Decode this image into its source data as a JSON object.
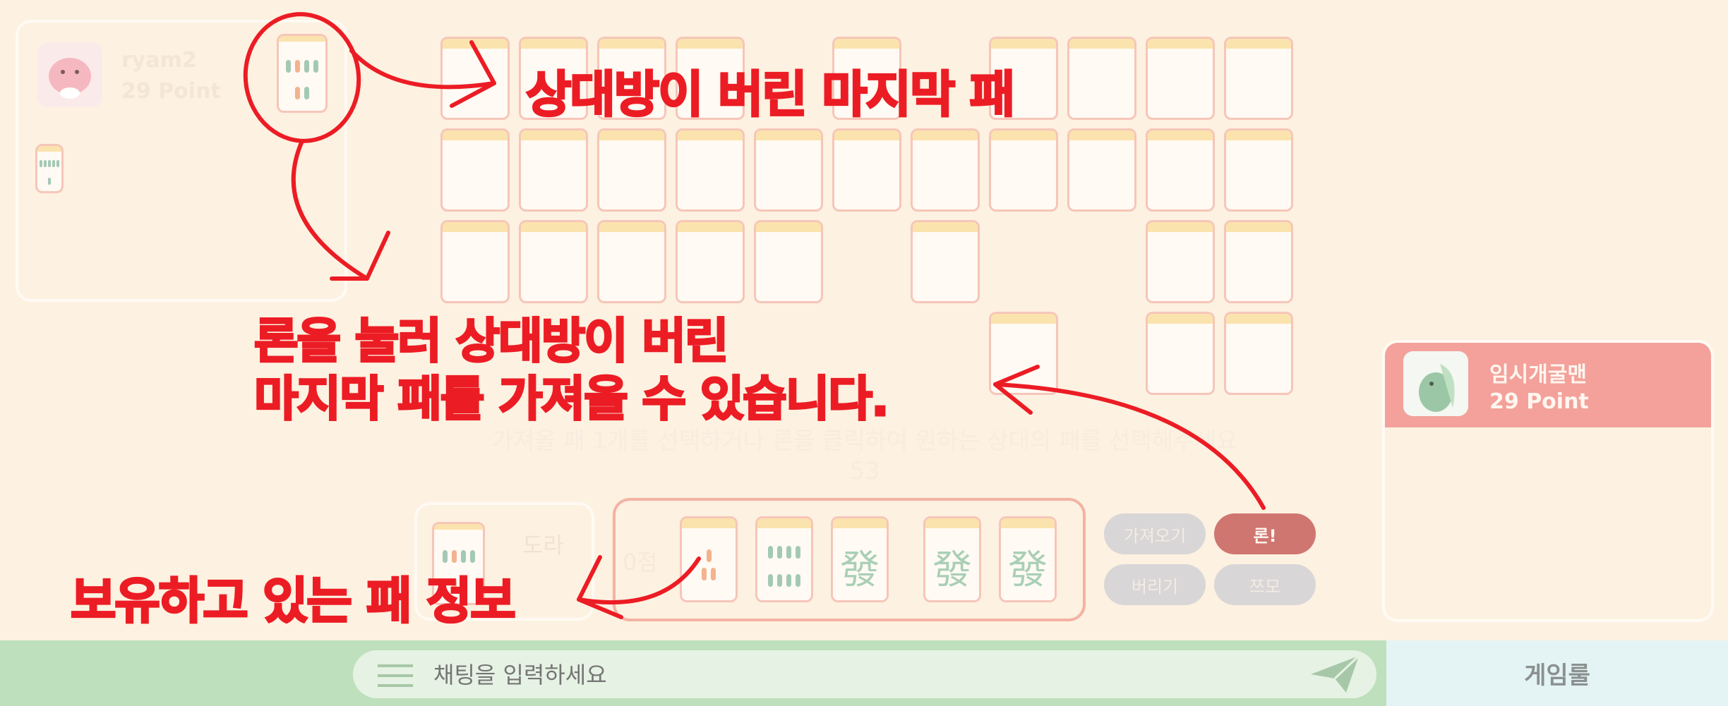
{
  "opponent": {
    "name": "ryam2",
    "points": "29 Point"
  },
  "player": {
    "name": "임시개굴맨",
    "points": "29 Point"
  },
  "board": {
    "instruction": "가져올 패 1개를 선택하거나 론을 클릭하여 원하는 상대의 패를 선택해주세요",
    "remaining_tiles": "53"
  },
  "hand": {
    "score": "0점",
    "dora_label": "도라",
    "tiles": [
      {
        "icon": "pin-tile-icon",
        "label": ""
      },
      {
        "icon": "pin-tile-icon",
        "label": ""
      },
      {
        "icon": "green-dragon-icon",
        "label": "發"
      },
      {
        "icon": "green-dragon-icon",
        "label": "發"
      },
      {
        "icon": "green-dragon-icon",
        "label": "發"
      }
    ]
  },
  "actions": {
    "take": "가져오기",
    "ron": "론!",
    "discard": "버리기",
    "tsumo": "쯔모"
  },
  "chat": {
    "placeholder": "채팅을 입력하세요"
  },
  "rules_button": "게임룰",
  "annotations": {
    "last_discard": "상대방이 버린 마지막 패",
    "ron_line1": "론을 눌러 상대방이 버린",
    "ron_line2": "마지막 패를 가져올 수 있습니다.",
    "hand_info": "보유하고 있는 패 정보"
  },
  "colors": {
    "background": "#fdf1e1",
    "annotation_red": "#ec1c24",
    "ron_button": "#cf7671",
    "player_header": "#f3a19a",
    "chat_bar": "#bee0bc"
  }
}
